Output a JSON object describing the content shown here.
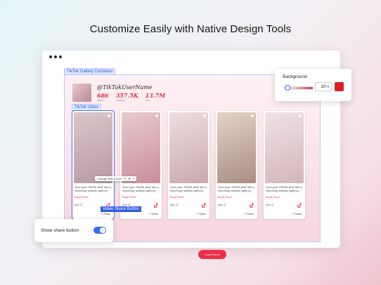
{
  "headline": "Customize Easily with Native Design Tools",
  "editor": {
    "gallery_label": "TikTok Gallery Container",
    "video_label": "TikTok Video",
    "video_share_tag": "Video Share Button",
    "toolbar_label": "Change Text & Icon"
  },
  "profile": {
    "name": "@TikTokUserName",
    "stats": [
      {
        "value": "686",
        "label": "Videos"
      },
      {
        "value": "357.5K",
        "label": "Followers"
      },
      {
        "value": "13.7M",
        "label": "Likes"
      }
    ]
  },
  "cards": [
    {
      "caption": "Turn your TikTok feed into a charming website gallery...",
      "read_more": "Read More",
      "date": "April 22",
      "share": "Share",
      "colors": [
        "#dcc6c9",
        "#b79aa3"
      ]
    },
    {
      "caption": "Turn your TikTok feed into a charming website gallery...",
      "read_more": "Read More",
      "date": "April 22",
      "share": "Share",
      "colors": [
        "#e8c9cc",
        "#c98f9a"
      ]
    },
    {
      "caption": "Turn your TikTok feed into a charming website gallery...",
      "read_more": "Read More",
      "date": "April 22",
      "share": "Share",
      "colors": [
        "#eedde0",
        "#c9a9ac"
      ]
    },
    {
      "caption": "Turn your TikTok feed into a charming website gallery...",
      "read_more": "Read More",
      "date": "April 22",
      "share": "Share",
      "colors": [
        "#e4d3c5",
        "#a98d84"
      ]
    },
    {
      "caption": "Turn your TikTok feed into a charming website gallery...",
      "read_more": "Read More",
      "date": "April 22",
      "share": "Share",
      "colors": [
        "#f0e2e4",
        "#d3b5bb"
      ]
    }
  ],
  "load_more": "Load More",
  "background_panel": {
    "title": "Background",
    "opacity": "10",
    "opacity_unit": "%",
    "color": "#e01c20",
    "slider_level_fraction": 0.1
  },
  "share_panel": {
    "label": "Show share button",
    "toggle_on": true
  },
  "colors": {
    "accent_red": "#ec2f4b",
    "editor_blue": "#2f5de0"
  }
}
